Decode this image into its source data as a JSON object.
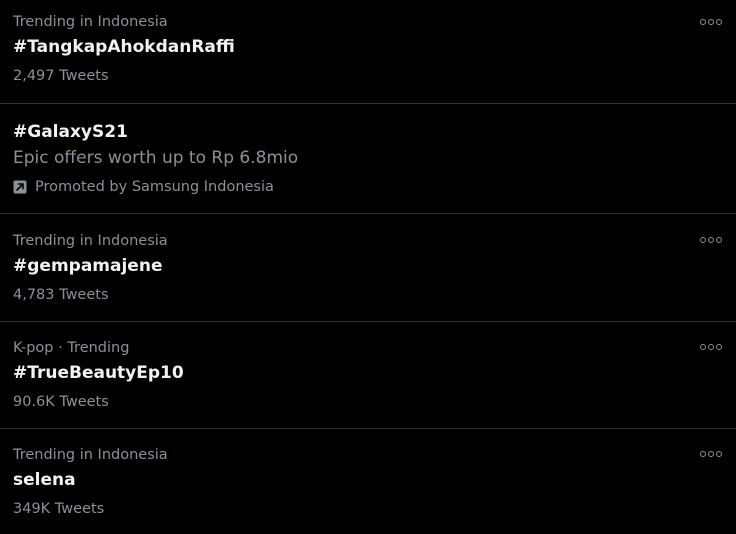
{
  "trends": [
    {
      "meta": "Trending in Indonesia",
      "title": "#TangkapAhokdanRaffi",
      "count": "2,497 Tweets"
    },
    {
      "title": "#GalaxyS21",
      "description": "Epic offers worth up to Rp 6.8mio",
      "promoted": "Promoted by Samsung Indonesia"
    },
    {
      "meta": "Trending in Indonesia",
      "title": "#gempamajene",
      "count": "4,783 Tweets"
    },
    {
      "meta": "K-pop · Trending",
      "title": "#TrueBeautyEp10",
      "count": "90.6K Tweets"
    },
    {
      "meta": "Trending in Indonesia",
      "title": "selena",
      "count": "349K Tweets"
    }
  ],
  "icons": {
    "more": "more-horizontal-icon",
    "promoted": "promoted-arrow-icon"
  },
  "colors": {
    "background": "#000000",
    "primary_text": "#f2f2f2",
    "secondary_text": "#8b9197",
    "divider": "#2f3336"
  }
}
